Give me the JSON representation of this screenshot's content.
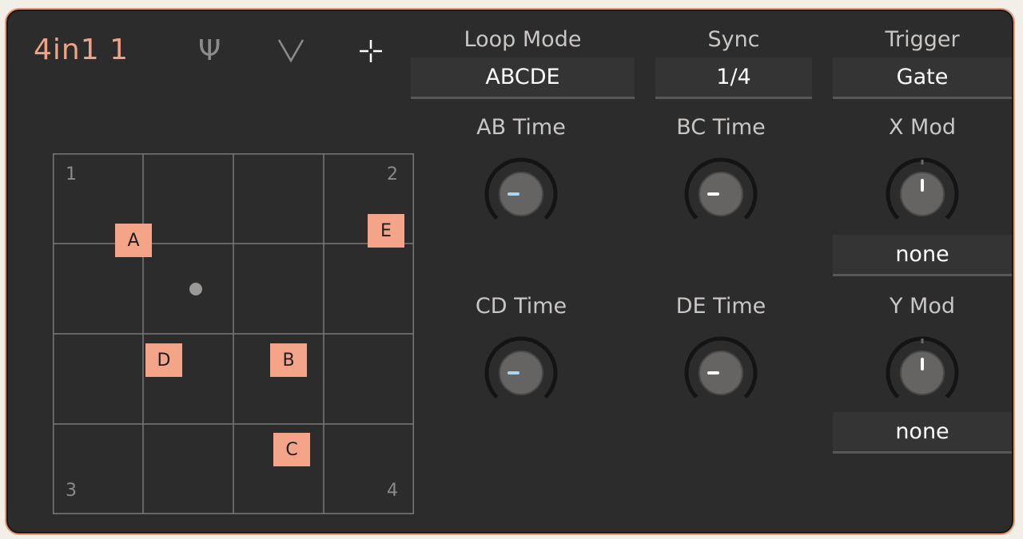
{
  "header": {
    "title": "4in1 1",
    "icons": [
      "psi-mode-icon",
      "v-mode-icon",
      "move-crosshair-icon"
    ]
  },
  "loop_mode": {
    "label": "Loop Mode",
    "value": "ABCDE"
  },
  "sync": {
    "label": "Sync",
    "value": "1/4"
  },
  "trigger": {
    "label": "Trigger",
    "value": "Gate"
  },
  "knobs": {
    "ab": {
      "label": "AB Time"
    },
    "bc": {
      "label": "BC Time"
    },
    "cd": {
      "label": "CD Time"
    },
    "de": {
      "label": "DE Time"
    },
    "xmod": {
      "label": "X Mod",
      "source": "none"
    },
    "ymod": {
      "label": "Y Mod",
      "source": "none"
    }
  },
  "grid": {
    "corners": [
      "1",
      "2",
      "3",
      "4"
    ],
    "nodes": [
      "A",
      "B",
      "C",
      "D",
      "E"
    ]
  },
  "colors": {
    "accent": "#f4a488",
    "panel": "#2d2c2c",
    "border": "#e79873"
  }
}
